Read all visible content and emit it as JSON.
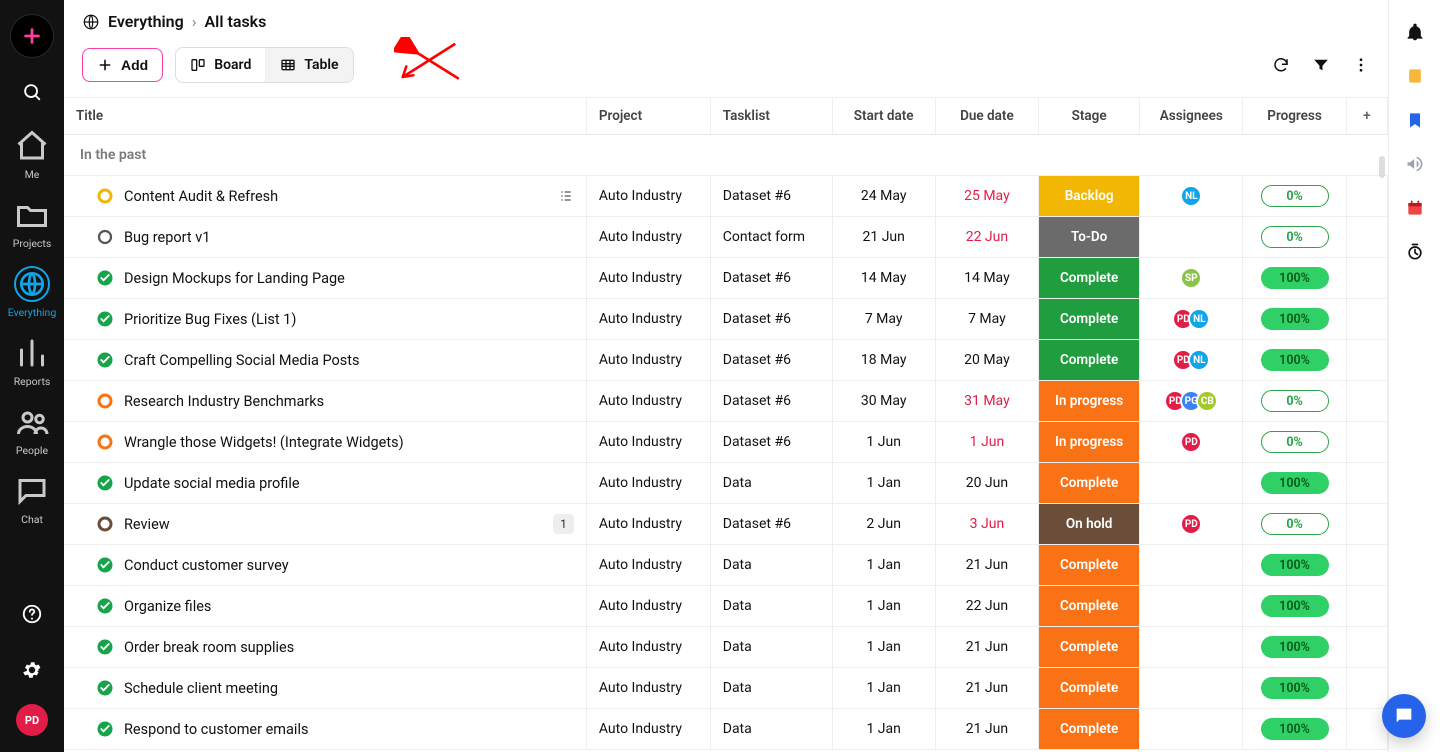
{
  "sidebar": {
    "items": [
      {
        "id": "me",
        "label": "Me"
      },
      {
        "id": "projects",
        "label": "Projects"
      },
      {
        "id": "everything",
        "label": "Everything",
        "active": true
      },
      {
        "id": "reports",
        "label": "Reports"
      },
      {
        "id": "people",
        "label": "People"
      },
      {
        "id": "chat",
        "label": "Chat"
      }
    ],
    "avatar": "PD"
  },
  "breadcrumbs": {
    "root": "Everything",
    "leaf": "All tasks"
  },
  "toolbar": {
    "add_label": "Add",
    "board_label": "Board",
    "table_label": "Table"
  },
  "columns": {
    "title": "Title",
    "project": "Project",
    "tasklist": "Tasklist",
    "start": "Start date",
    "due": "Due date",
    "stage": "Stage",
    "assignees": "Assignees",
    "progress": "Progress"
  },
  "group_label": "In the past",
  "stages": {
    "Backlog": "Backlog",
    "To-Do": "To-Do",
    "Complete": "Complete",
    "In progress": "In progress",
    "On hold": "On hold"
  },
  "rows": [
    {
      "status": "ring-yellow",
      "title": "Content Audit & Refresh",
      "hasSubtasks": true,
      "project": "Auto Industry",
      "tasklist": "Dataset #6",
      "start": "24 May",
      "due": "25 May",
      "dueOverdue": true,
      "stage": "Backlog",
      "stageClass": "stage-Backlog",
      "assignees": [
        "NL"
      ],
      "progress": 0
    },
    {
      "status": "ring-gray",
      "title": "Bug report v1",
      "project": "Auto Industry",
      "tasklist": "Contact form",
      "start": "21 Jun",
      "due": "22 Jun",
      "dueOverdue": true,
      "stage": "To-Do",
      "stageClass": "stage-To-Do",
      "assignees": [],
      "progress": 0
    },
    {
      "status": "check-green",
      "title": "Design Mockups for Landing Page",
      "project": "Auto Industry",
      "tasklist": "Dataset #6",
      "start": "14 May",
      "due": "14 May",
      "stage": "Complete",
      "stageClass": "stage-Complete-green",
      "assignees": [
        "SP"
      ],
      "progress": 100
    },
    {
      "status": "check-green",
      "title": "Prioritize Bug Fixes (List 1)",
      "project": "Auto Industry",
      "tasklist": "Dataset #6",
      "start": "7 May",
      "due": "7 May",
      "stage": "Complete",
      "stageClass": "stage-Complete-green",
      "assignees": [
        "PD",
        "NL"
      ],
      "progress": 100
    },
    {
      "status": "check-green",
      "title": "Craft Compelling Social Media Posts",
      "project": "Auto Industry",
      "tasklist": "Dataset #6",
      "start": "18 May",
      "due": "20 May",
      "stage": "Complete",
      "stageClass": "stage-Complete-green",
      "assignees": [
        "PD",
        "NL"
      ],
      "progress": 100
    },
    {
      "status": "ring-orange",
      "title": "Research Industry Benchmarks",
      "project": "Auto Industry",
      "tasklist": "Dataset #6",
      "start": "30 May",
      "due": "31 May",
      "dueOverdue": true,
      "stage": "In progress",
      "stageClass": "stage-In-progress",
      "assignees": [
        "PD",
        "PG",
        "CB"
      ],
      "progress": 0
    },
    {
      "status": "ring-orange",
      "title": "Wrangle those Widgets! (Integrate Widgets)",
      "project": "Auto Industry",
      "tasklist": "Dataset #6",
      "start": "1 Jun",
      "due": "1 Jun",
      "dueOverdue": true,
      "stage": "In progress",
      "stageClass": "stage-In-progress",
      "assignees": [
        "PD"
      ],
      "progress": 0
    },
    {
      "status": "check-green",
      "title": "Update social media profile",
      "project": "Auto Industry",
      "tasklist": "Data",
      "start": "1 Jan",
      "due": "20 Jun",
      "stage": "Complete",
      "stageClass": "stage-Complete-orange",
      "assignees": [],
      "progress": 100
    },
    {
      "status": "ring-brown",
      "title": "Review",
      "badge": "1",
      "project": "Auto Industry",
      "tasklist": "Dataset #6",
      "start": "2 Jun",
      "due": "3 Jun",
      "dueOverdue": true,
      "stage": "On hold",
      "stageClass": "stage-On-hold",
      "assignees": [
        "PD"
      ],
      "progress": 0
    },
    {
      "status": "check-green",
      "title": "Conduct customer survey",
      "project": "Auto Industry",
      "tasklist": "Data",
      "start": "1 Jan",
      "due": "21 Jun",
      "stage": "Complete",
      "stageClass": "stage-Complete-orange",
      "assignees": [],
      "progress": 100
    },
    {
      "status": "check-green",
      "title": "Organize files",
      "project": "Auto Industry",
      "tasklist": "Data",
      "start": "1 Jan",
      "due": "22 Jun",
      "stage": "Complete",
      "stageClass": "stage-Complete-orange",
      "assignees": [],
      "progress": 100
    },
    {
      "status": "check-green",
      "title": "Order break room supplies",
      "project": "Auto Industry",
      "tasklist": "Data",
      "start": "1 Jan",
      "due": "21 Jun",
      "stage": "Complete",
      "stageClass": "stage-Complete-orange",
      "assignees": [],
      "progress": 100
    },
    {
      "status": "check-green",
      "title": "Schedule client meeting",
      "project": "Auto Industry",
      "tasklist": "Data",
      "start": "1 Jan",
      "due": "21 Jun",
      "stage": "Complete",
      "stageClass": "stage-Complete-orange",
      "assignees": [],
      "progress": 100
    },
    {
      "status": "check-green",
      "title": "Respond to customer emails",
      "project": "Auto Industry",
      "tasklist": "Data",
      "start": "1 Jan",
      "due": "21 Jun",
      "stage": "Complete",
      "stageClass": "stage-Complete-orange",
      "assignees": [],
      "progress": 100
    }
  ]
}
